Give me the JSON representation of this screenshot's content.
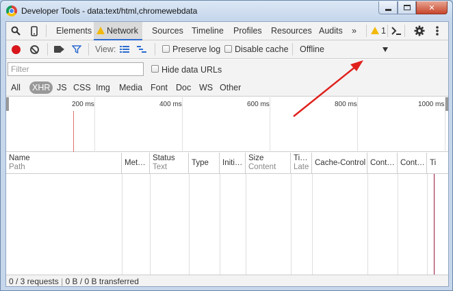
{
  "window": {
    "title": "Developer Tools - data:text/html,chromewebdata",
    "close_symbol": "✕"
  },
  "tabs": [
    {
      "label": "Elements"
    },
    {
      "label": "Network",
      "active": true
    },
    {
      "label": "Sources"
    },
    {
      "label": "Timeline"
    },
    {
      "label": "Profiles"
    },
    {
      "label": "Resources"
    },
    {
      "label": "Audits"
    }
  ],
  "tabbar": {
    "more": "»",
    "warning_count": "1",
    "console_icon": "console-prompt-icon",
    "settings_icon": "gear-icon",
    "menu_icon": "vertical-ellipsis-icon"
  },
  "toolbar": {
    "view_label": "View:",
    "preserve_log": "Preserve log",
    "disable_cache": "Disable cache",
    "throttle_value": "Offline"
  },
  "filter": {
    "placeholder": "Filter",
    "hide_data_urls": "Hide data URLs",
    "types": [
      "All",
      "XHR",
      "JS",
      "CSS",
      "Img",
      "Media",
      "Font",
      "Doc",
      "WS",
      "Other"
    ],
    "active_type": "XHR"
  },
  "overview": {
    "ticks": [
      "200 ms",
      "400 ms",
      "600 ms",
      "800 ms",
      "1000 ms"
    ]
  },
  "columns": [
    {
      "title": "Name",
      "sub": "Path"
    },
    {
      "title": "Met…",
      "sub": ""
    },
    {
      "title": "Status",
      "sub": "Text"
    },
    {
      "title": "Type",
      "sub": ""
    },
    {
      "title": "Initi…",
      "sub": ""
    },
    {
      "title": "Size",
      "sub": "Content"
    },
    {
      "title": "Ti…",
      "sub": "Late"
    },
    {
      "title": "Cache-Control",
      "sub": ""
    },
    {
      "title": "Cont…",
      "sub": ""
    },
    {
      "title": "Cont…",
      "sub": ""
    },
    {
      "title": "Ti",
      "sub": ""
    }
  ],
  "status": {
    "requests": "0 / 3 requests",
    "transferred": "0 B / 0 B transferred"
  },
  "colors": {
    "record": "#d8161b",
    "active_tab_underline": "#2a6bd0",
    "annotation_arrow": "#e0201c"
  }
}
